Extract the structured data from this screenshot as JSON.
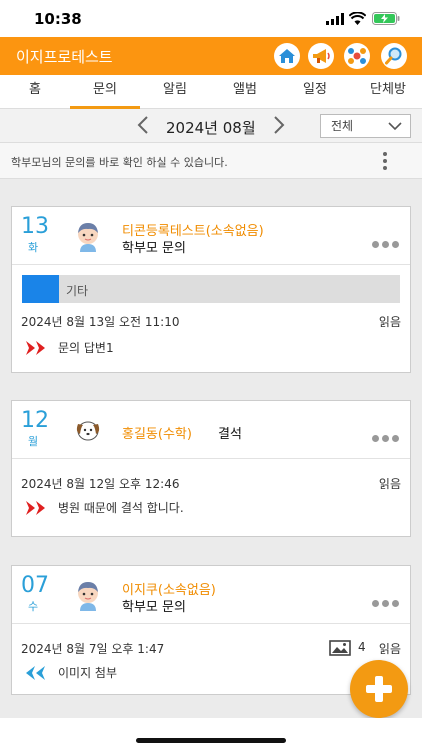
{
  "status": {
    "time": "10:38"
  },
  "app": {
    "title": "이지프로테스트"
  },
  "tabs": [
    {
      "label": "홈"
    },
    {
      "label": "문의"
    },
    {
      "label": "알림"
    },
    {
      "label": "앨범"
    },
    {
      "label": "일정"
    },
    {
      "label": "단체방"
    }
  ],
  "active_tab": "문의",
  "month": {
    "label": "2024년 08월",
    "filter": "전체"
  },
  "info": {
    "text": "학부모님의 문의를 바로 확인 하실 수 있습니다."
  },
  "cards": [
    {
      "day": "13",
      "weekday": "화",
      "name": "티콘등록테스트(소속없음)",
      "subtitle": "학부모 문의",
      "category": "기타",
      "datetime": "2024년 8월 13일 오전 11:10",
      "read": "읽음",
      "reply": "문의 답변1"
    },
    {
      "day": "12",
      "weekday": "월",
      "name": "홍길동(수학)",
      "subtitle": "결석",
      "datetime": "2024년 8월 12일 오후 12:46",
      "read": "읽음",
      "reply": "병원 때문에 결석 합니다."
    },
    {
      "day": "07",
      "weekday": "수",
      "name": "이지쿠(소속없음)",
      "subtitle": "학부모 문의",
      "datetime": "2024년 8월 7일 오후 1:47",
      "image_count": "4",
      "read": "읽음",
      "reply": "이미지 첨부"
    }
  ],
  "icons": {
    "appbar": [
      "home-icon",
      "megaphone-icon",
      "share-icon",
      "search-icon"
    ],
    "reply_red": "double-chevron-right-icon",
    "reply_blue": "double-chevron-left-icon"
  },
  "colors": {
    "accent": "#fc9510",
    "blue": "#2a9fd8",
    "name": "#f08c00"
  }
}
